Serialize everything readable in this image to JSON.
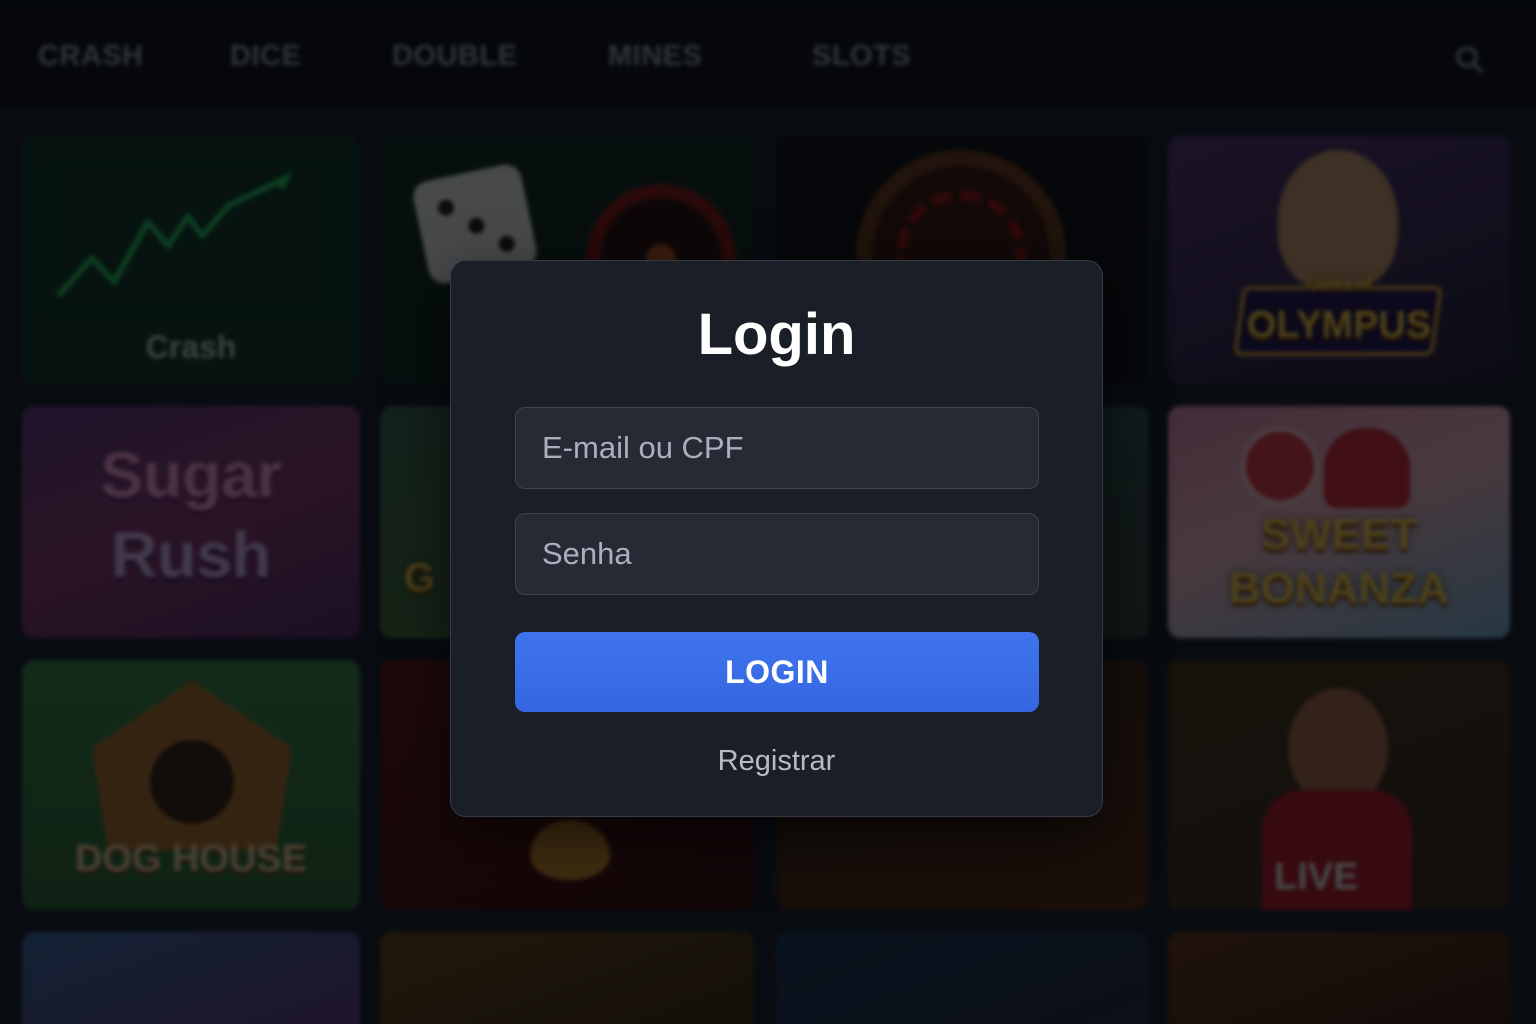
{
  "nav": {
    "items": [
      "CRASH",
      "DICE",
      "DOUBLE",
      "MINES",
      "SLOTS"
    ],
    "search_icon": "search-icon"
  },
  "games": {
    "crash_label": "Crash",
    "olympus_small": "Gates of",
    "olympus_title": "OLYMPUS",
    "sugar_line1": "Sugar",
    "sugar_line2": "Rush",
    "sweet_line1": "SWEET",
    "sweet_line2": "BONANZA",
    "doghouse_title": "DOG HOUSE",
    "live_label": "LIVE",
    "partial_letter": "G"
  },
  "modal": {
    "title": "Login",
    "email_placeholder": "E-mail ou CPF",
    "password_placeholder": "Senha",
    "login_button": "LOGIN",
    "register_link": "Registrar"
  },
  "colors": {
    "accent": "#3b6ee8",
    "modal_bg": "#1a1e26",
    "page_bg": "#0b0e14"
  }
}
